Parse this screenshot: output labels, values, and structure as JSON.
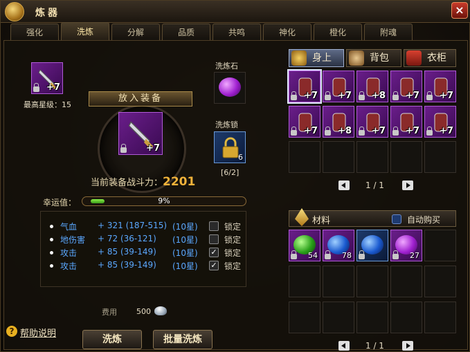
{
  "window": {
    "title": "炼器"
  },
  "tabs": [
    {
      "label": "强化"
    },
    {
      "label": "洗炼"
    },
    {
      "label": "分解"
    },
    {
      "label": "品质"
    },
    {
      "label": "共鸣"
    },
    {
      "label": "神化"
    },
    {
      "label": "橙化"
    },
    {
      "label": "附魂"
    }
  ],
  "left": {
    "top_item": {
      "level": "+7",
      "max_star_text": "最高星级：15"
    },
    "stone": {
      "label": "洗炼石"
    },
    "lock_item": {
      "label": "洗炼锁",
      "qty": "6",
      "count_text": "[6/2]"
    },
    "place_banner": "放入装备",
    "center_item": {
      "level": "+7"
    },
    "power": {
      "label": "当前装备战斗力：",
      "value": "2201"
    },
    "luck": {
      "label": "幸运值：",
      "percent_text": "9%",
      "percent": 9
    },
    "stats": [
      {
        "name": "气血",
        "value": "+ 321 (187-515)",
        "star": "(10星)",
        "locked": false,
        "lock_label": "锁定"
      },
      {
        "name": "地伤害",
        "value": "+ 72 (36-121)",
        "star": "(10星)",
        "locked": false,
        "lock_label": "锁定"
      },
      {
        "name": "攻击",
        "value": "+ 85 (39-149)",
        "star": "(10星)",
        "locked": true,
        "lock_label": "锁定"
      },
      {
        "name": "攻击",
        "value": "+ 85 (39-149)",
        "star": "(10星)",
        "locked": true,
        "lock_label": "锁定"
      }
    ],
    "cost": {
      "label": "费用",
      "value": "500"
    },
    "help_label": "帮助说明",
    "buttons": {
      "refine": "洗炼",
      "batch": "批量洗炼"
    }
  },
  "right": {
    "tabs": [
      {
        "label": "身上"
      },
      {
        "label": "背包"
      },
      {
        "label": "衣柜"
      }
    ],
    "equip_levels": [
      "+7",
      "+7",
      "+8",
      "+7",
      "+7",
      "+7",
      "+8",
      "+7",
      "+7",
      "+7"
    ],
    "pager1": "1 / 1",
    "materials": {
      "label": "材料",
      "auto_buy": "自动购买",
      "qtys": [
        "54",
        "78",
        "",
        "27"
      ]
    },
    "pager2": "1 / 1"
  }
}
